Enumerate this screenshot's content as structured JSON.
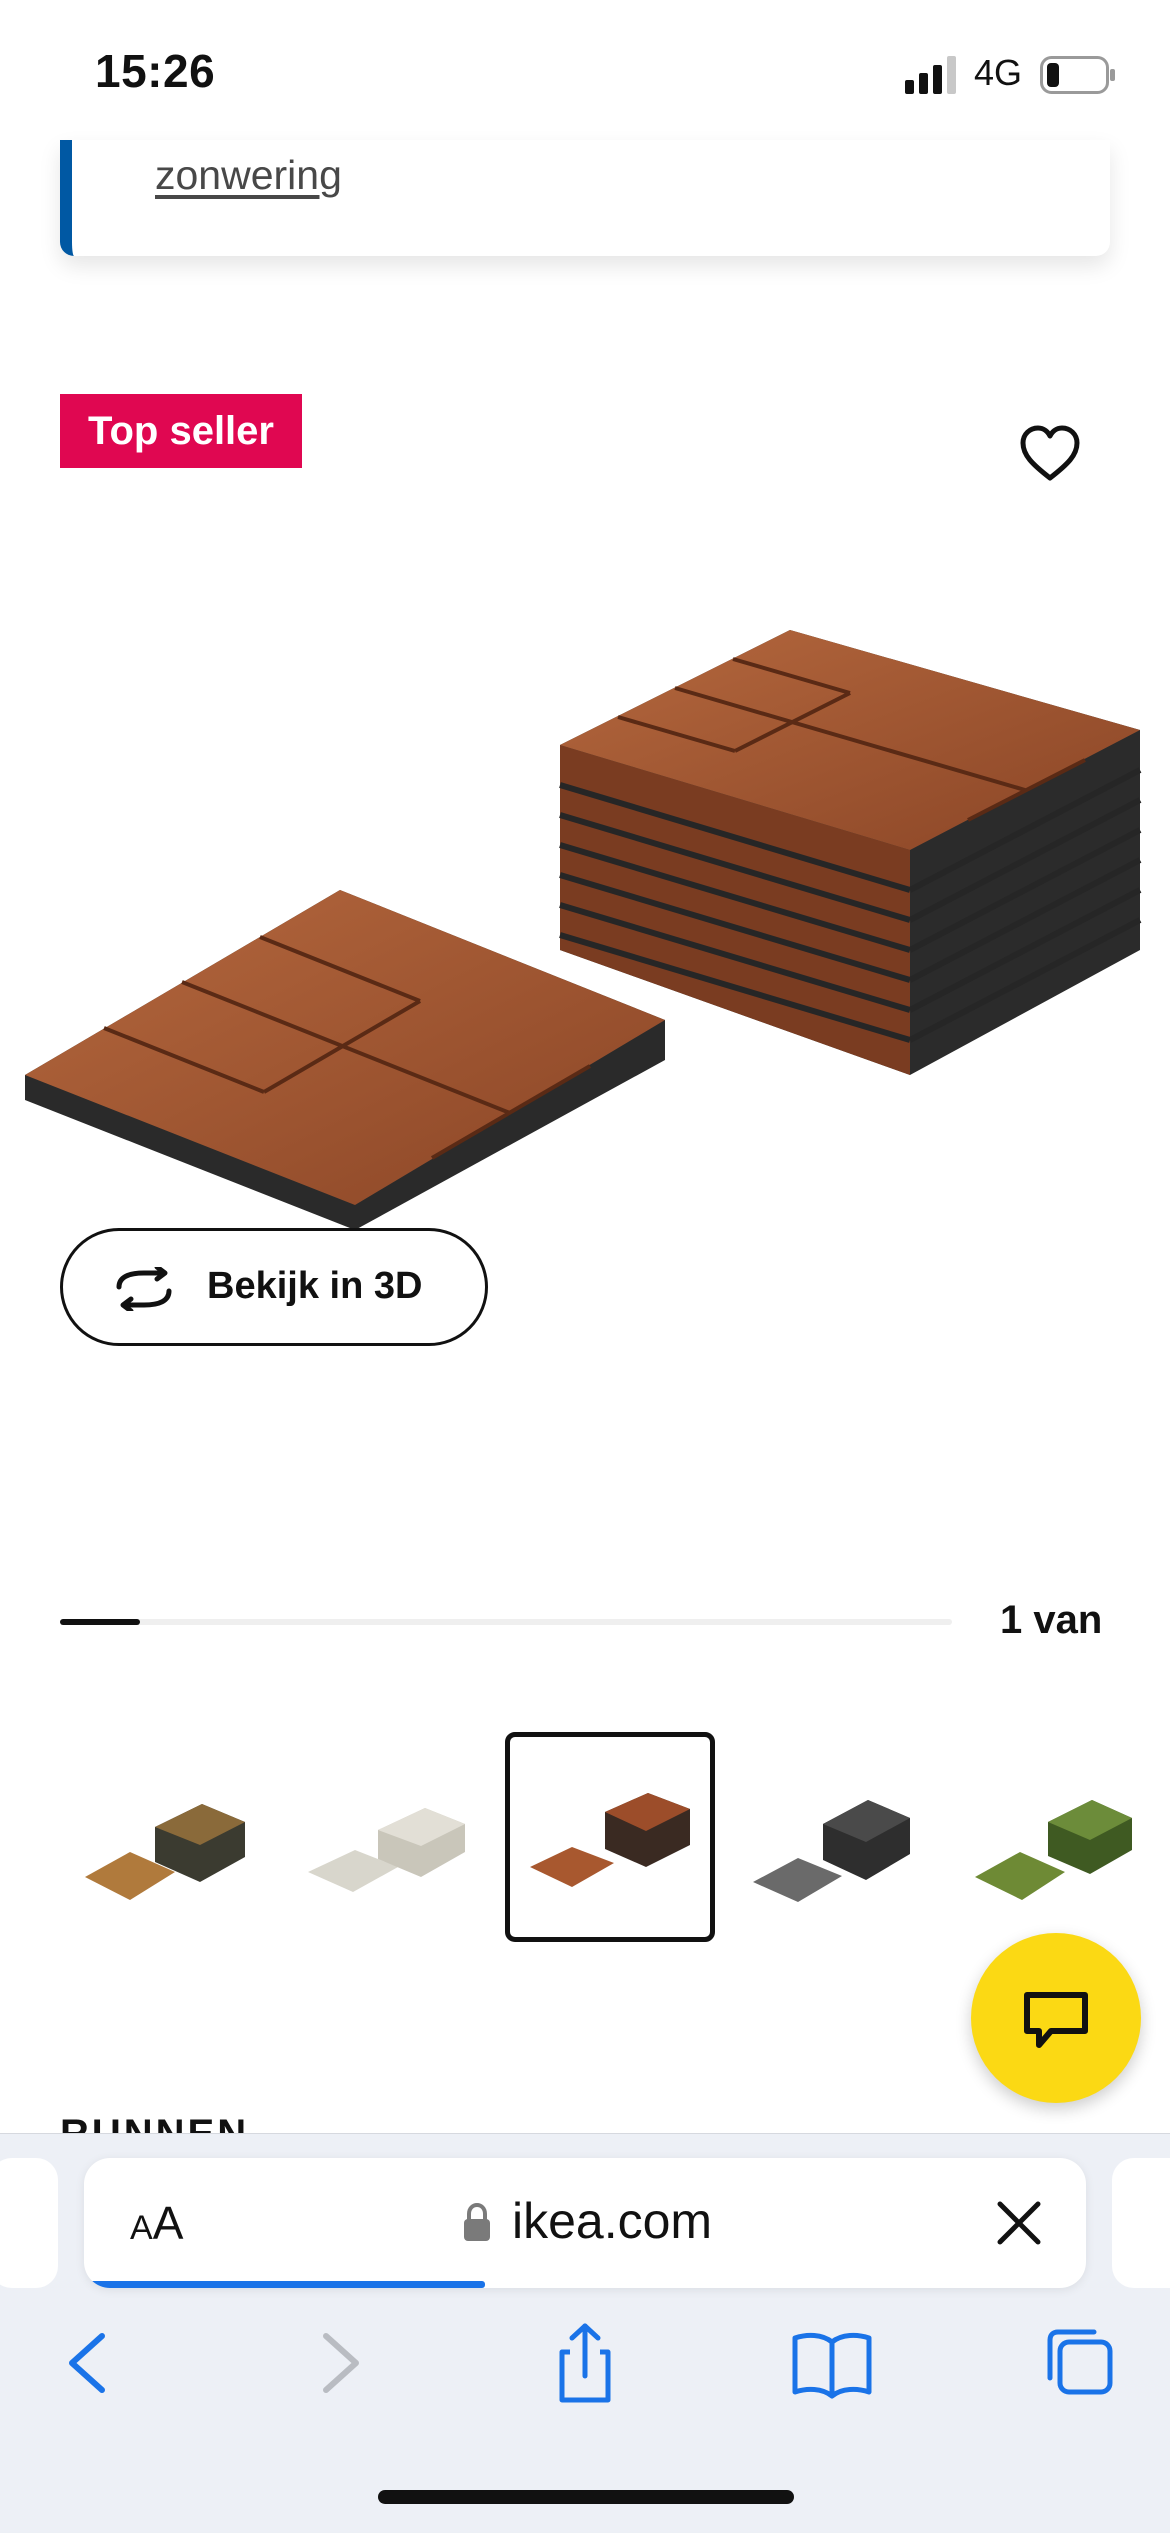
{
  "status_bar": {
    "time": "15:26",
    "network": "4G"
  },
  "info_card": {
    "link_text": "zonwering"
  },
  "product": {
    "badge": "Top seller",
    "view_3d_label": "Bekijk in 3D",
    "carousel": {
      "progress_label": "1 van",
      "progress_fraction": 0.09
    },
    "thumbnails": [
      {
        "variant": "brown-stain"
      },
      {
        "variant": "light-grey"
      },
      {
        "variant": "brown-red",
        "selected": true
      },
      {
        "variant": "dark-grey"
      },
      {
        "variant": "artificial-grass"
      }
    ],
    "next_section_heading": "RUNNEN"
  },
  "browser": {
    "text_size_label_small": "A",
    "text_size_label_large": "A",
    "url": "ikea.com",
    "load_progress": 0.4
  },
  "colors": {
    "badge": "#e00751",
    "accent_blue": "#0058a3",
    "chat_yellow": "#fbd914",
    "safari_blue": "#1a73e8"
  },
  "icons": [
    "signal-icon",
    "battery-icon",
    "heart-icon",
    "rotate-3d-icon",
    "chat-icon",
    "lock-icon",
    "close-icon",
    "back-icon",
    "forward-icon",
    "share-icon",
    "bookmarks-icon",
    "tabs-icon"
  ]
}
